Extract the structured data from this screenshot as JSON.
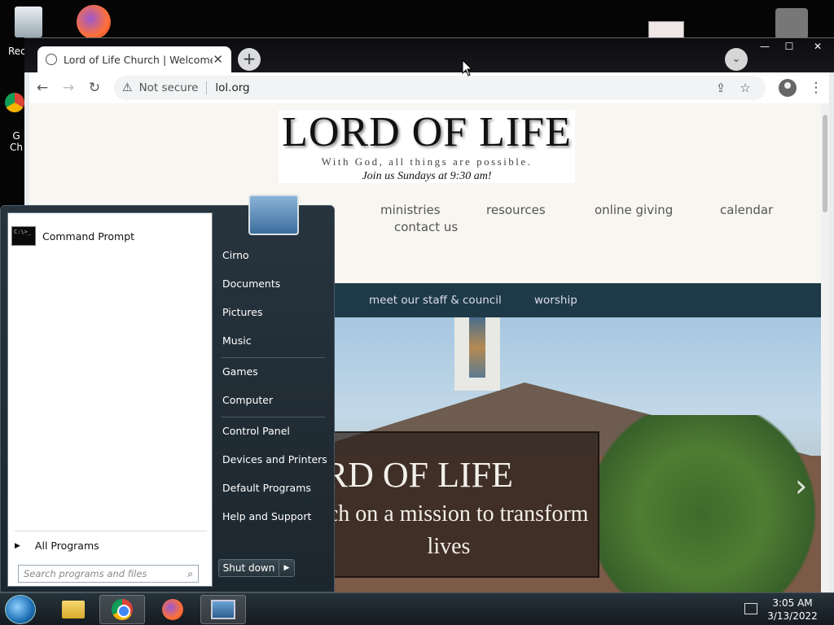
{
  "desktop": {
    "icons": [
      {
        "label": "Rec"
      },
      {
        "label": "G"
      },
      {
        "label": "Ch"
      }
    ]
  },
  "browser": {
    "tab_title": "Lord of Life Church | Welcome",
    "tab_close": "✕",
    "new_tab": "+",
    "tab_search": "⌄",
    "window_controls": {
      "minimize": "—",
      "maximize": "☐",
      "close": "✕"
    },
    "nav_back": "←",
    "nav_forward": "→",
    "reload": "↻",
    "security_label": "Not secure",
    "url": "lol.org",
    "share_icon": "⇪",
    "star_icon": "☆",
    "menu_icon": "⋮"
  },
  "site": {
    "logo_title": "LORD OF LIFE",
    "logo_tagline": "With God, all things are possible.",
    "logo_join": "Join us Sundays at 9:30 am!",
    "nav": [
      "ministries",
      "resources",
      "online giving",
      "calendar",
      "contact us"
    ],
    "subnav": [
      "meet our staff & council",
      "worship"
    ],
    "hero_title": "ORD OF LIFE",
    "hero_subtitle": "urch on a mission to transform lives",
    "hero_next": "›"
  },
  "start_menu": {
    "pinned": [
      {
        "label": "Command Prompt",
        "icon": "cmd-icon"
      }
    ],
    "all_programs": "All Programs",
    "search_placeholder": "Search programs and files",
    "right_links": [
      "Cirno",
      "Documents",
      "Pictures",
      "Music",
      "Games",
      "Computer",
      "Control Panel",
      "Devices and Printers",
      "Default Programs",
      "Help and Support"
    ],
    "shutdown_label": "Shut down"
  },
  "taskbar": {
    "apps": [
      "folder-icon",
      "chrome-icon",
      "firefox-icon",
      "screen-icon"
    ],
    "time": "3:05 AM",
    "date": "3/13/2022"
  }
}
